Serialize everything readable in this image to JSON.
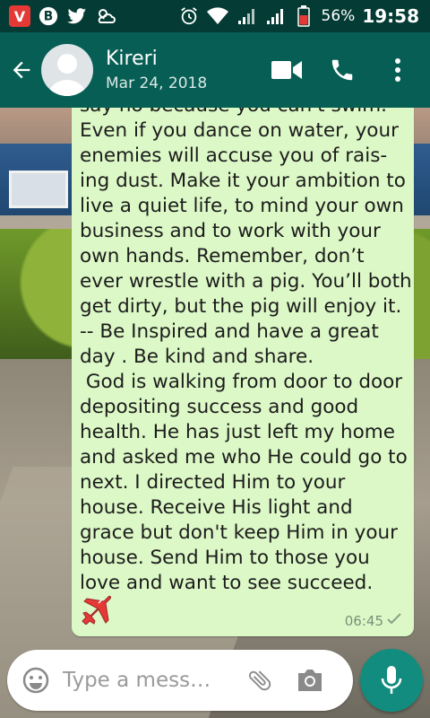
{
  "status_bar": {
    "battery": "56%",
    "time": "19:58",
    "icons": [
      "vivo-app-icon",
      "bitcoin-icon",
      "twitter-icon",
      "weather-icon",
      "alarm-icon",
      "wifi-icon",
      "signal-icon",
      "signal-icon",
      "battery-icon"
    ]
  },
  "header": {
    "contact_name": "Kireri",
    "last_seen": "Mar 24, 2018",
    "icons": [
      "back-arrow-icon",
      "avatar",
      "video-call-icon",
      "phone-icon",
      "more-vert-icon"
    ]
  },
  "message": {
    "text": "say no because you can't swim.\nEven if you dance on water, your enemies will accuse you of rais-ing dust. Make it your ambition to live a quiet life, to mind your own business and to work with your own hands. Remember, don’t ever wrestle with a pig. You’ll both get dirty, but the pig will enjoy it. -- Be Inspired and have a great day . Be kind and share.\n God is walking from door to door depositing success and good health. He has just left my home and asked me who He could go to next. I directed Him to your house. Receive His light and grace but don't keep Him in your house. Send Him to those you love and want to see succeed.",
    "emoji": "airplane-emoji",
    "time": "06:45",
    "status_icon": "check-icon"
  },
  "composer": {
    "placeholder": "Type a mess…",
    "icons": [
      "emoji-icon",
      "attach-icon",
      "camera-icon",
      "mic-icon"
    ]
  },
  "colors": {
    "status_bar": "#043b34",
    "header": "#075e54",
    "bubble": "#dcf8c6",
    "mic_button": "#128c7e"
  }
}
